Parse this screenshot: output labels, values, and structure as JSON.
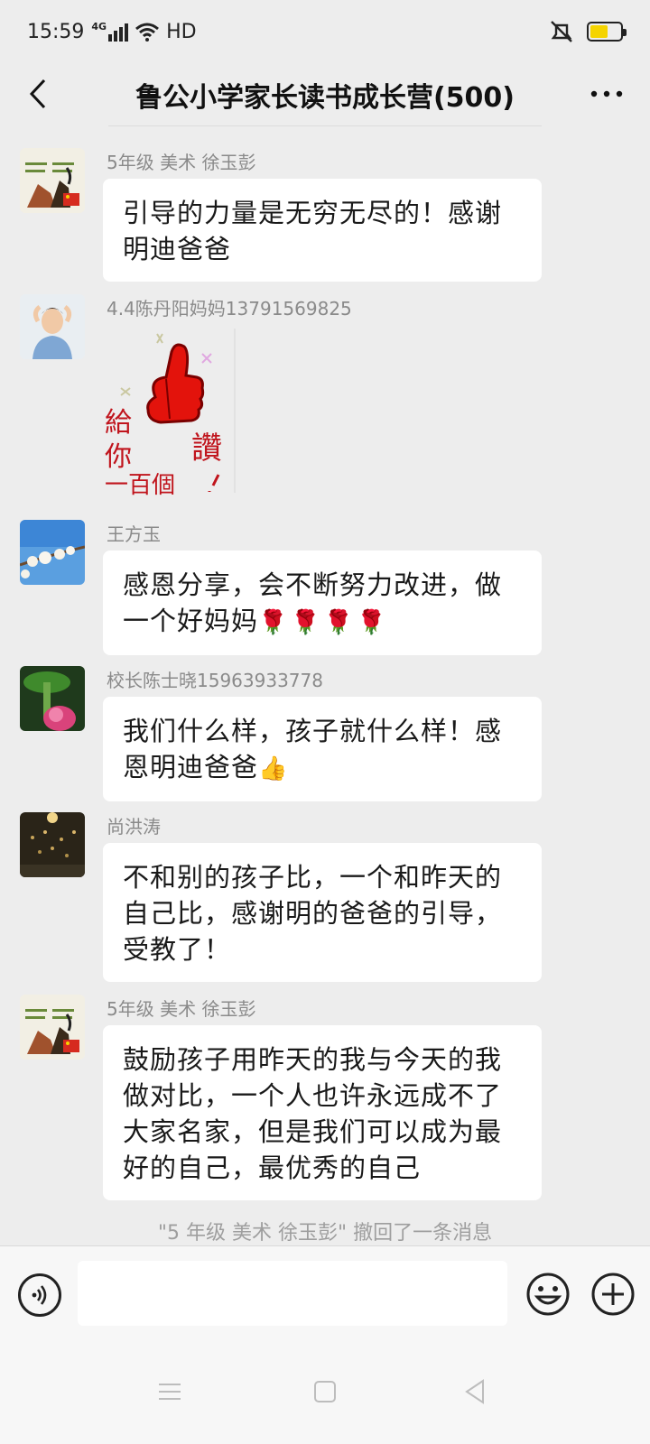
{
  "status_bar": {
    "time": "15:59",
    "network": "4G",
    "hd": "HD"
  },
  "header": {
    "title": "鲁公小学家长读书成长营(500)"
  },
  "messages": [
    {
      "sender": "5年级 美术 徐玉彭",
      "text": "引导的力量是无穷无尽的！感谢明迪爸爸",
      "avatar": "painting-avatar"
    },
    {
      "sender": "4.4陈丹阳妈妈13791569825",
      "sticker_lines": [
        "給",
        "你",
        "一百個",
        "讚"
      ],
      "avatar": "woman-photo-avatar"
    },
    {
      "sender": "王方玉",
      "text": "感恩分享，会不断努力改进，做一个好妈妈",
      "emoji": "🌹🌹🌹🌹",
      "avatar": "blossom-avatar"
    },
    {
      "sender": "校长陈士晓15963933778",
      "text": "我们什么样，孩子就什么样！感恩明迪爸爸",
      "emoji": "👍",
      "avatar": "lotus-avatar"
    },
    {
      "sender": "尚洪涛",
      "text": "不和别的孩子比，一个和昨天的自己比，感谢明的爸爸的引导，受教了！",
      "avatar": "night-lights-avatar"
    },
    {
      "sender": "5年级 美术 徐玉彭",
      "text": "鼓励孩子用昨天的我与今天的我做对比，一个人也许永远成不了大家名家，但是我们可以成为最好的自己，最优秀的自己",
      "avatar": "painting-avatar"
    }
  ],
  "recall_notice": "\"5 年级 美术 徐玉彭\" 撤回了一条消息",
  "input": {
    "value": "",
    "placeholder": ""
  },
  "colors": {
    "background": "#ededed",
    "bubble": "#ffffff",
    "sender": "#8a8a8a"
  }
}
